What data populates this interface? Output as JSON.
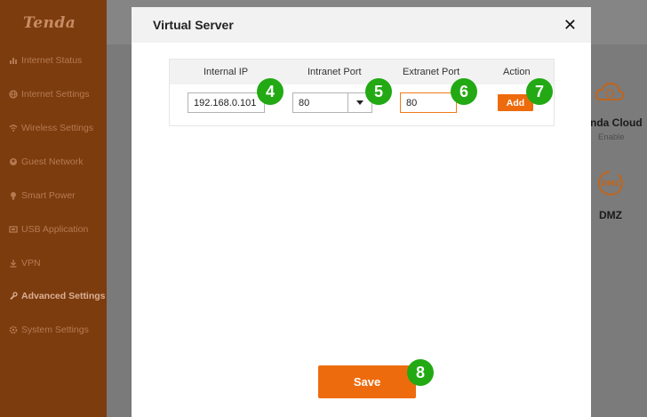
{
  "sidebar": {
    "logo": "Tenda",
    "items": [
      {
        "label": "Internet Status",
        "icon": "chart-icon"
      },
      {
        "label": "Internet Settings",
        "icon": "globe-icon"
      },
      {
        "label": "Wireless Settings",
        "icon": "wifi-icon"
      },
      {
        "label": "Guest Network",
        "icon": "guest-icon"
      },
      {
        "label": "Smart Power",
        "icon": "bulb-icon"
      },
      {
        "label": "USB Application",
        "icon": "usb-icon"
      },
      {
        "label": "VPN",
        "icon": "vpn-icon"
      },
      {
        "label": "Advanced Settings",
        "icon": "wrench-icon",
        "active": true
      },
      {
        "label": "System Settings",
        "icon": "gear-icon"
      }
    ]
  },
  "background": {
    "tiles": [
      {
        "label": "nda Cloud",
        "sub": "Enable",
        "icon": "cloud-gear-icon"
      },
      {
        "label": "DMZ",
        "icon": "dmz-icon"
      }
    ]
  },
  "modal": {
    "title": "Virtual Server",
    "close": "✕",
    "columns": [
      "Internal IP",
      "Intranet Port",
      "Extranet Port",
      "Action"
    ],
    "row": {
      "internal_ip": "192.168.0.101",
      "intranet_port": "80",
      "extranet_port": "80",
      "action": "Add"
    },
    "save_label": "Save"
  },
  "badges": [
    "4",
    "5",
    "6",
    "7",
    "8"
  ],
  "colors": {
    "accent": "#ee6b0d",
    "badge": "#22a914",
    "sidebar": "#7d3c0e"
  }
}
